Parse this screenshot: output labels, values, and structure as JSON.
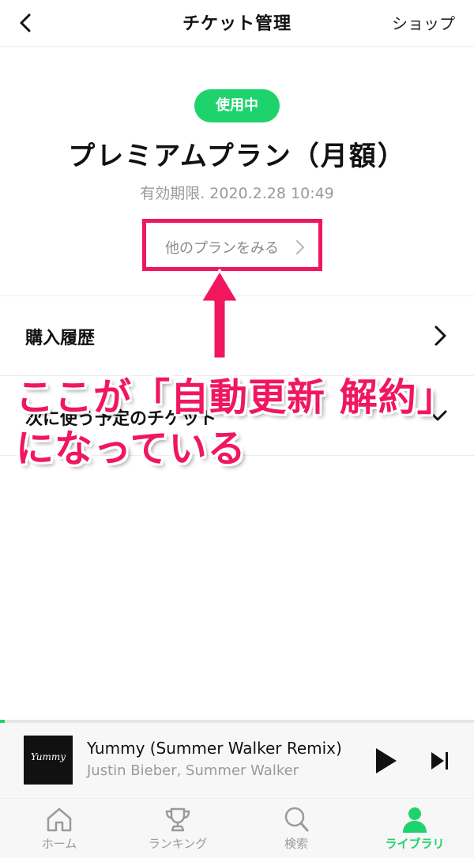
{
  "header": {
    "title": "チケット管理",
    "shop_label": "ショップ"
  },
  "plan": {
    "status_badge": "使用中",
    "name": "プレミアムプラン（月額）",
    "expiry": "有効期限. 2020.2.28 10:49",
    "other_plans_link": "他のプランをみる"
  },
  "menu": {
    "purchase_history": "購入履歴",
    "next_ticket": "次に使う予定のチケット"
  },
  "annotation": {
    "line1": "ここが「自動更新 解約」",
    "line2": "になっている"
  },
  "player": {
    "album_art_text": "Yummy",
    "song_title": "Yummy (Summer Walker Remix)",
    "artist": "Justin Bieber, Summer Walker",
    "progress_fraction": 0.01
  },
  "tabs": [
    {
      "label": "ホーム",
      "icon": "home-icon"
    },
    {
      "label": "ランキング",
      "icon": "trophy-icon"
    },
    {
      "label": "検索",
      "icon": "search-icon"
    },
    {
      "label": "ライブラリ",
      "icon": "person-icon",
      "active": true
    }
  ],
  "colors": {
    "accent_green": "#1fd36c",
    "annotation_pink": "#f0175f"
  }
}
